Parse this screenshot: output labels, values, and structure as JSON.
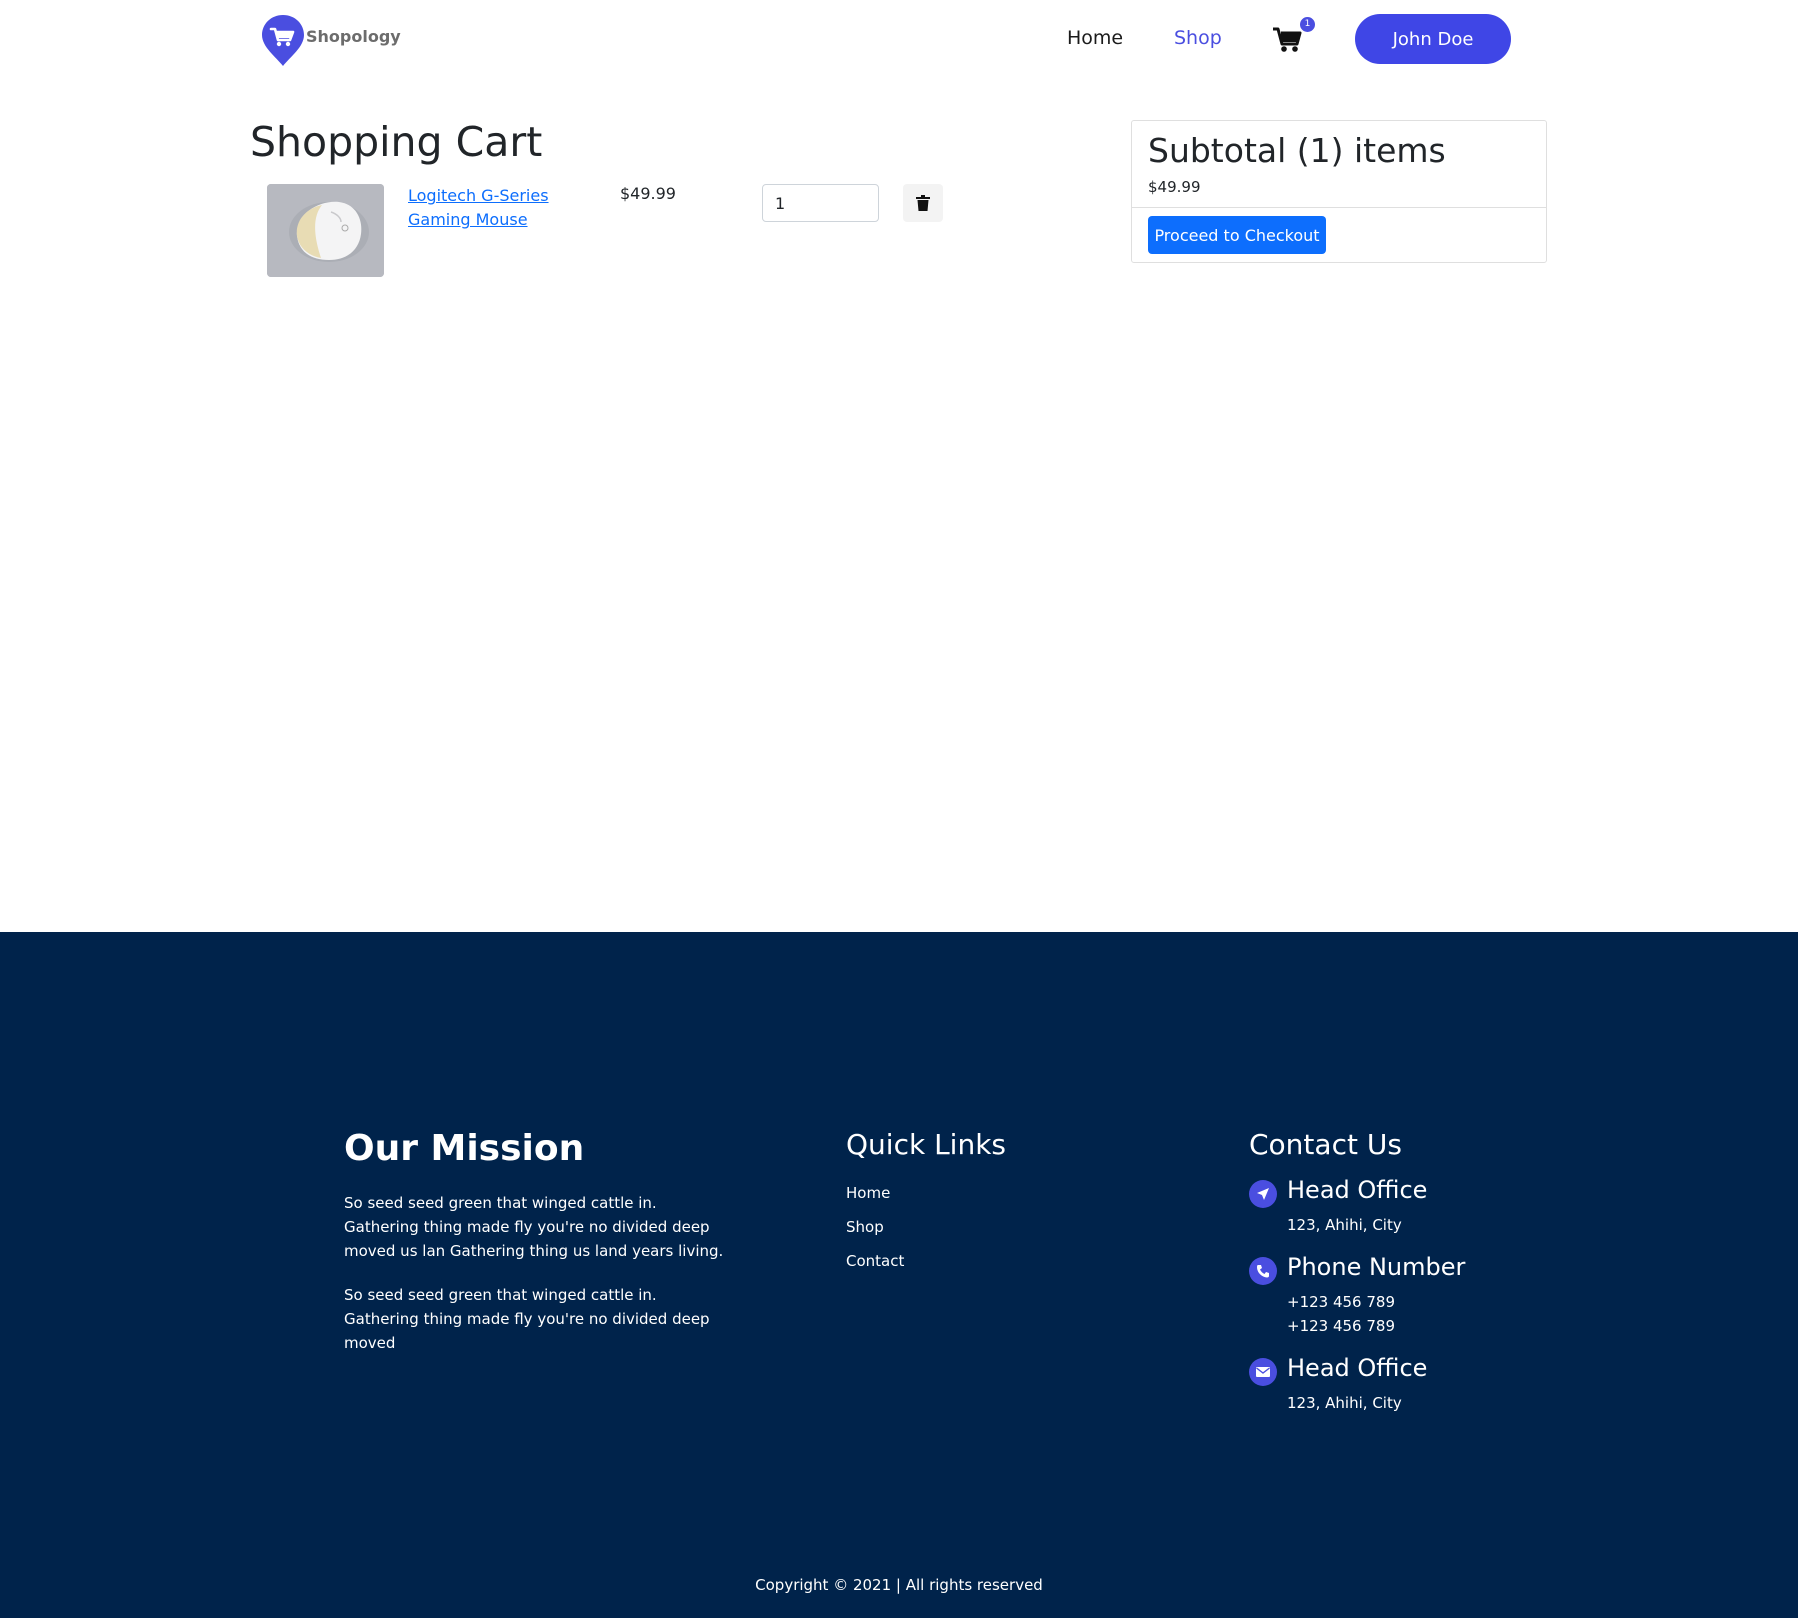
{
  "header": {
    "logo_text": "Shopology",
    "nav": {
      "home": "Home",
      "shop": "Shop"
    },
    "cart_count": "1",
    "user_name": "John Doe"
  },
  "cart": {
    "title": "Shopping Cart",
    "items": [
      {
        "name": "Logitech G-Series Gaming Mouse",
        "price": "$49.99",
        "quantity": "1"
      }
    ],
    "summary": {
      "title": "Subtotal (1) items",
      "total": "$49.99",
      "checkout_label": "Proceed to Checkout"
    }
  },
  "footer": {
    "mission": {
      "title": "Our Mission",
      "paragraphs": [
        "So seed seed green that winged cattle in. Gathering thing made fly you're no divided deep moved us lan Gathering thing us land years living.",
        "So seed seed green that winged cattle in. Gathering thing made fly you're no divided deep moved"
      ]
    },
    "quick_links": {
      "title": "Quick Links",
      "links": [
        "Home",
        "Shop",
        "Contact"
      ]
    },
    "contact": {
      "title": "Contact Us",
      "entries": [
        {
          "icon": "location-arrow-icon",
          "heading": "Head Office",
          "lines": [
            "123, Ahihi, City"
          ]
        },
        {
          "icon": "phone-icon",
          "heading": "Phone Number",
          "lines": [
            "+123 456 789",
            "+123 456 789"
          ]
        },
        {
          "icon": "envelope-icon",
          "heading": "Head Office",
          "lines": [
            "123, Ahihi, City"
          ]
        }
      ]
    },
    "copyright": "Copyright © 2021 | All rights reserved"
  },
  "colors": {
    "accent": "#4a4ee0",
    "user_button": "#3f46e6",
    "primary_button": "#0d6efd",
    "footer_bg": "#00234b"
  }
}
